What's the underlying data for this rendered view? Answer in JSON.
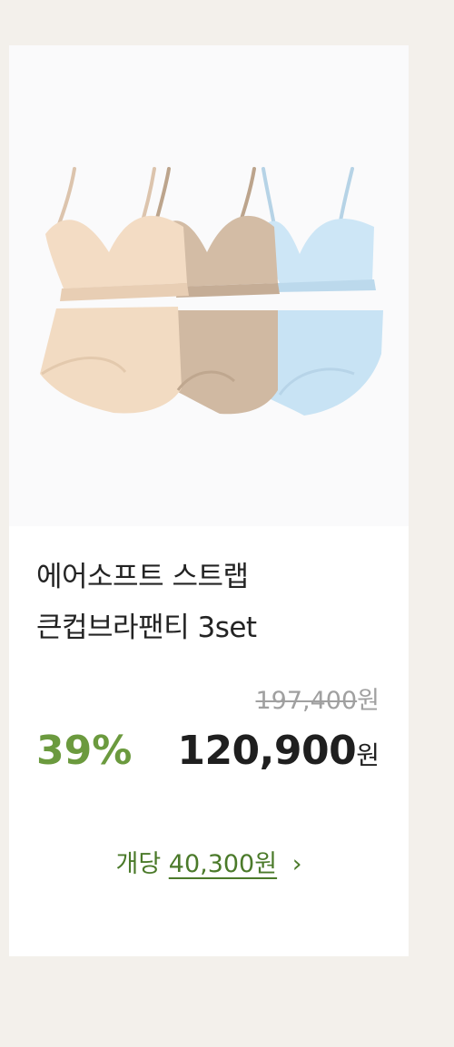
{
  "product": {
    "image_alt": "3-color bra and panty set",
    "title_line1": "에어소프트 스트랩",
    "title_line2": "큰컵브라팬티 3set",
    "original_price": "197,400",
    "original_currency": "원",
    "discount": "39%",
    "sale_price": "120,900",
    "sale_currency": "원",
    "per_unit_label": "개당",
    "per_unit_price": "40,300원",
    "chevron": "›"
  },
  "colors": {
    "accent_green": "#6b9a3e",
    "per_unit_green": "#4b7a2a",
    "nude": "#f3dcc4",
    "mocha": "#d3bca5",
    "sky": "#cde6f6"
  }
}
